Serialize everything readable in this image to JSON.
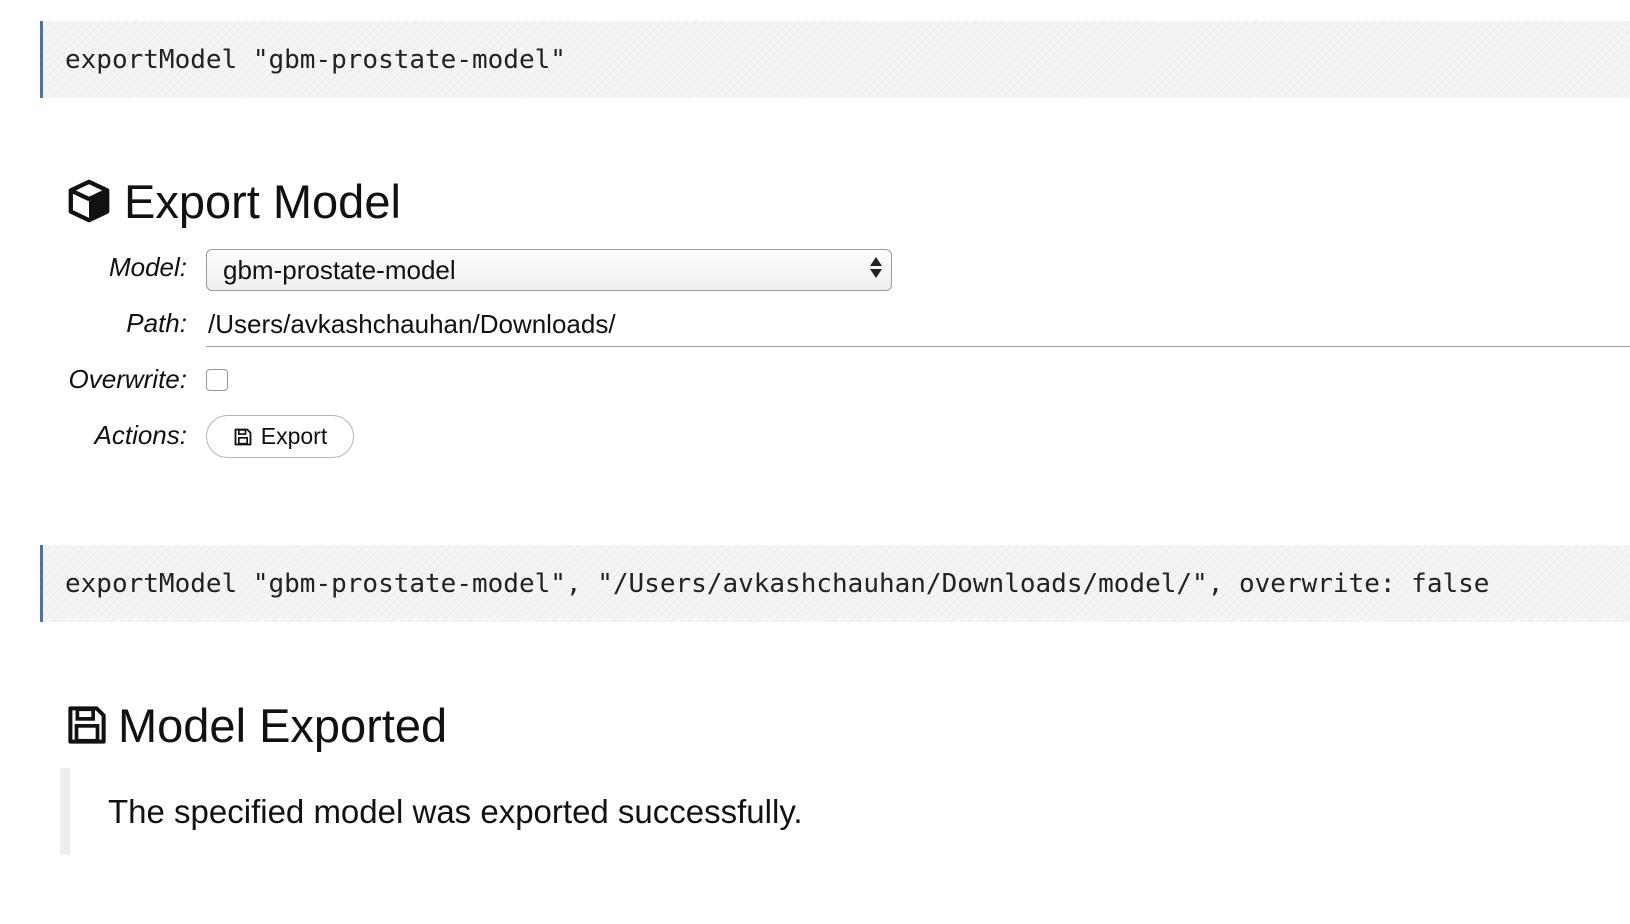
{
  "cells": {
    "first_command": "exportModel \"gbm-prostate-model\"",
    "second_command": "exportModel \"gbm-prostate-model\", \"/Users/avkashchauhan/Downloads/model/\", overwrite: false"
  },
  "export_form": {
    "title": "Export Model",
    "title_icon": "cube-icon",
    "model_label": "Model:",
    "model_selected": "gbm-prostate-model",
    "path_label": "Path:",
    "path_value": "/Users/avkashchauhan/Downloads/",
    "overwrite_label": "Overwrite:",
    "overwrite_checked": false,
    "actions_label": "Actions:",
    "export_button_label": "Export",
    "export_button_icon": "floppy-disk-icon"
  },
  "result": {
    "title": "Model Exported",
    "title_icon": "floppy-disk-icon",
    "message": "The specified model was exported successfully."
  },
  "colors": {
    "cell_border": "#4a6fb5",
    "cell_background": "#f4f4f4",
    "text": "#111111"
  }
}
